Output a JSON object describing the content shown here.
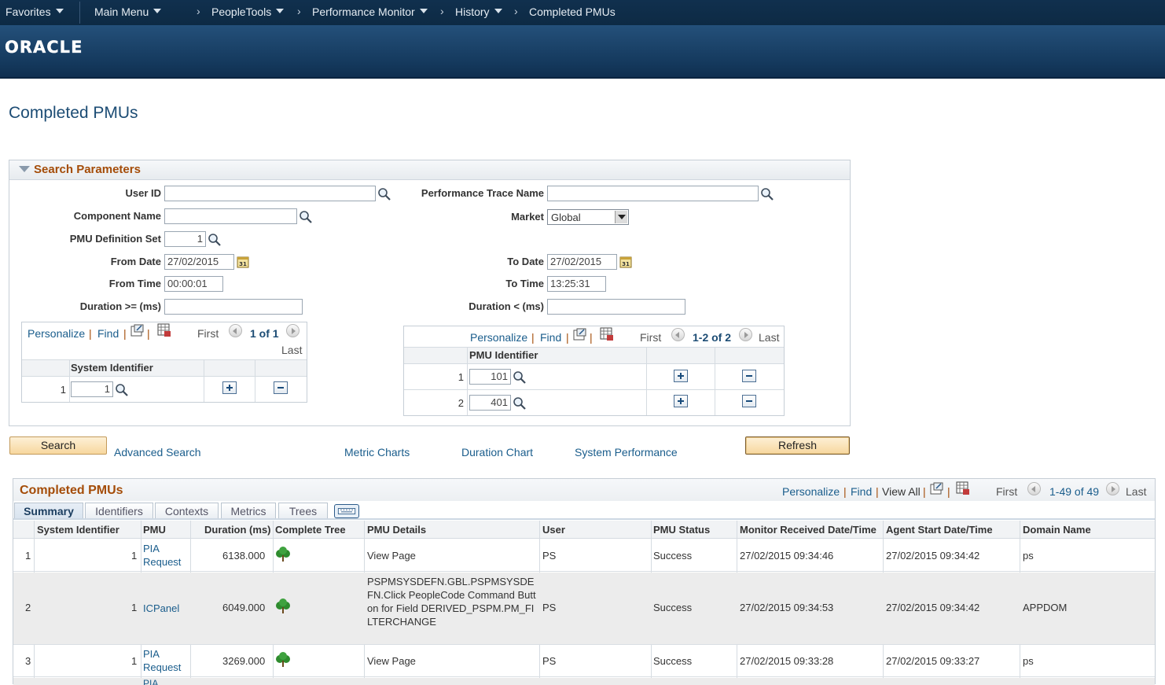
{
  "nav": {
    "favorites": "Favorites",
    "main_menu": "Main Menu",
    "breadcrumb": [
      "PeopleTools",
      "Performance Monitor",
      "History",
      "Completed PMUs"
    ]
  },
  "brand": {
    "logo_text": "ORACLE"
  },
  "page_title": "Completed PMUs",
  "search_params": {
    "title": "Search Parameters",
    "user_id": {
      "label": "User ID",
      "value": ""
    },
    "performance_trace_name": {
      "label": "Performance Trace Name",
      "value": ""
    },
    "component_name": {
      "label": "Component Name",
      "value": ""
    },
    "market": {
      "label": "Market",
      "value": "Global"
    },
    "pmu_definition_set": {
      "label": "PMU Definition Set",
      "value": "1"
    },
    "from_date": {
      "label": "From Date",
      "value": "27/02/2015"
    },
    "to_date": {
      "label": "To Date",
      "value": "27/02/2015"
    },
    "from_time": {
      "label": "From Time",
      "value": "00:00:01"
    },
    "to_time": {
      "label": "To Time",
      "value": "13:25:31"
    },
    "duration_ge": {
      "label": "Duration >= (ms)",
      "value": ""
    },
    "duration_lt": {
      "label": "Duration < (ms)",
      "value": ""
    }
  },
  "grid_toolbar": {
    "personalize": "Personalize",
    "find": "Find",
    "view_all": "View All",
    "first": "First",
    "last": "Last",
    "bar": "|"
  },
  "system_grid": {
    "range": "1 of 1",
    "header": "System Identifier",
    "rows": [
      {
        "num": "1",
        "value": "1"
      }
    ]
  },
  "pmu_grid": {
    "range": "1-2 of 2",
    "header": "PMU Identifier",
    "rows": [
      {
        "num": "1",
        "value": "101"
      },
      {
        "num": "2",
        "value": "401"
      }
    ]
  },
  "actions": {
    "search": "Search",
    "advanced_search": "Advanced Search",
    "metric_charts": "Metric Charts",
    "duration_chart": "Duration Chart",
    "system_performance": "System Performance",
    "refresh": "Refresh"
  },
  "completed": {
    "title": "Completed PMUs",
    "range": "1-49 of 49",
    "tabs": [
      "Summary",
      "Identifiers",
      "Contexts",
      "Metrics",
      "Trees"
    ],
    "columns": [
      "System Identifier",
      "PMU",
      "Duration (ms)",
      "Complete Tree",
      "PMU Details",
      "User",
      "PMU Status",
      "Monitor Received Date/Time",
      "Agent Start Date/Time",
      "Domain Name"
    ],
    "rows": [
      {
        "num": "1",
        "sys": "1",
        "pmu": "PIA Request",
        "duration": "6138.000",
        "details": "View Page",
        "user": "PS",
        "status": "Success",
        "received": "27/02/2015 09:34:46",
        "agent_start": "27/02/2015 09:34:42",
        "domain": "ps"
      },
      {
        "num": "2",
        "sys": "1",
        "pmu": "ICPanel",
        "duration": "6049.000",
        "details": "PSPMSYSDEFN.GBL.PSPMSYSDEFN.Click PeopleCode Command Button for Field DERIVED_PSPM.PM_FILTERCHANGE",
        "user": "PS",
        "status": "Success",
        "received": "27/02/2015 09:34:53",
        "agent_start": "27/02/2015 09:34:42",
        "domain": "APPDOM"
      },
      {
        "num": "3",
        "sys": "1",
        "pmu": "PIA Request",
        "duration": "3269.000",
        "details": "View Page",
        "user": "PS",
        "status": "Success",
        "received": "27/02/2015 09:33:28",
        "agent_start": "27/02/2015 09:33:27",
        "domain": "ps"
      },
      {
        "num": "",
        "sys": "",
        "pmu": "PIA",
        "duration": "",
        "details": "",
        "user": "",
        "status": "",
        "received": "",
        "agent_start": "",
        "domain": ""
      }
    ]
  }
}
